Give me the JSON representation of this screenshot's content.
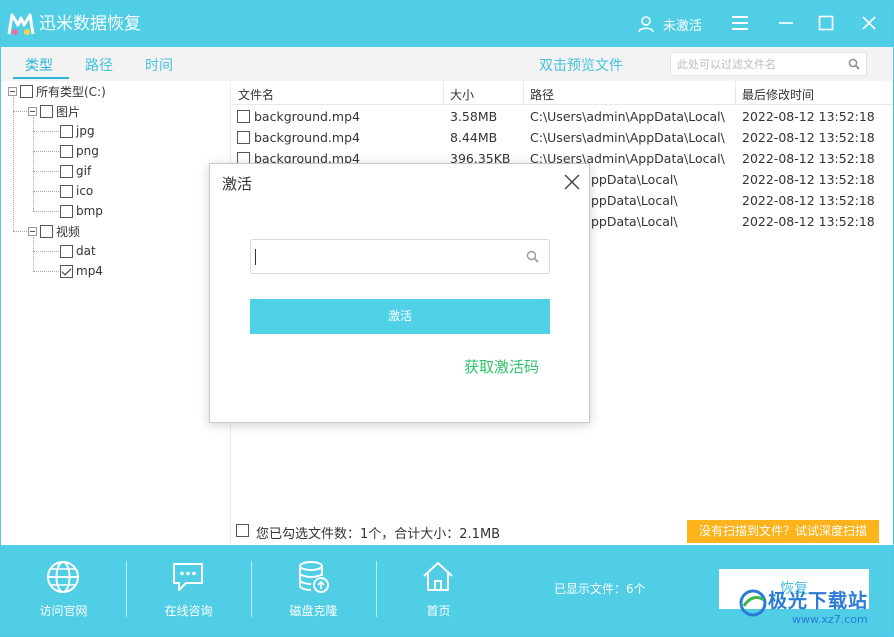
{
  "app": {
    "title": "迅米数据恢复",
    "user_status": "未激活"
  },
  "tabs": [
    {
      "label": "类型"
    },
    {
      "label": "路径"
    },
    {
      "label": "时间"
    }
  ],
  "preview_link": "双击预览文件",
  "filter": {
    "placeholder": "此处可以过滤文件名",
    "value": ""
  },
  "tree": {
    "root": "所有类型(C:)",
    "groups": [
      {
        "label": "图片",
        "items": [
          "jpg",
          "png",
          "gif",
          "ico",
          "bmp"
        ]
      },
      {
        "label": "视频",
        "items": [
          "dat",
          "mp4"
        ],
        "checked": "mp4"
      }
    ]
  },
  "table": {
    "headers": [
      "文件名",
      "大小",
      "路径",
      "最后修改时间"
    ],
    "rows": [
      {
        "name": "background.mp4",
        "size": "3.58MB",
        "path": "C:\\Users\\admin\\AppData\\Local\\",
        "time": "2022-08-12 13:52:18"
      },
      {
        "name": "background.mp4",
        "size": "8.44MB",
        "path": "C:\\Users\\admin\\AppData\\Local\\",
        "time": "2022-08-12 13:52:18"
      },
      {
        "name": "background.mp4",
        "size": "396.35KB",
        "path": "C:\\Users\\admin\\AppData\\Local\\",
        "time": "2022-08-12 13:52:18"
      },
      {
        "name": "",
        "size": "",
        "path": "ppData\\Local\\",
        "time": "2022-08-12 13:52:18"
      },
      {
        "name": "",
        "size": "",
        "path": "ppData\\Local\\",
        "time": "2022-08-12 13:52:18"
      },
      {
        "name": "",
        "size": "",
        "path": "ppData\\Local\\",
        "time": "2022-08-12 13:52:18"
      }
    ]
  },
  "status": {
    "text": "您已勾选文件数：1个，合计大小：2.1MB",
    "deep_scan": "没有扫描到文件？试试深度扫描"
  },
  "bottom_nav": [
    {
      "label": "访问官网"
    },
    {
      "label": "在线咨询"
    },
    {
      "label": "磁盘克隆"
    },
    {
      "label": "首页"
    }
  ],
  "shown_count": "已显示文件：6个",
  "recover_button": "恢复",
  "watermark": {
    "text": "极光下载站",
    "url": "www.xz7.com"
  },
  "dialog": {
    "title": "激活",
    "input_value": "",
    "activate_button": "激活",
    "get_code_link": "获取激活码"
  }
}
